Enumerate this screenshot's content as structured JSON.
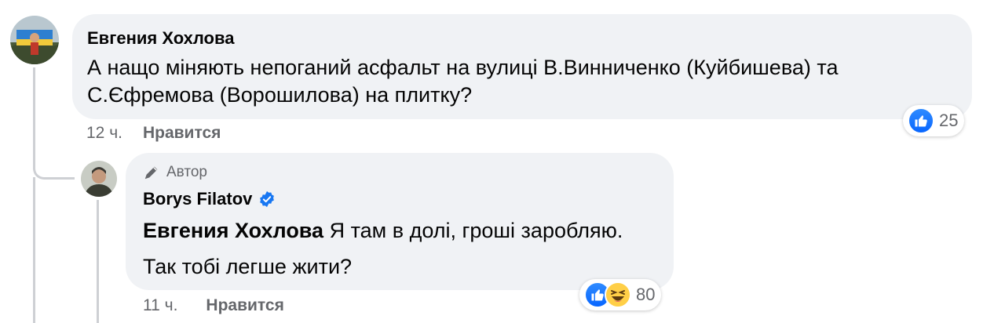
{
  "comment1": {
    "author": "Евгения Хохлова",
    "line1": "А нащо міняють непоганий асфальт на вулиці В.Винниченко (Куйбишева) та",
    "line2": "С.Єфремова (Ворошилова) на плитку?",
    "time": "12 ч.",
    "like_label": "Нравится",
    "reaction_count": "25"
  },
  "reply1": {
    "author_badge": "Автор",
    "author": "Borys Filatov",
    "mention": "Евгения Хохлова",
    "text1": "Я там в долі, гроші заробляю.",
    "text2": "Так тобі легше жити?",
    "time": "11 ч.",
    "like_label": "Нравится",
    "reaction_count": "80"
  },
  "colors": {
    "bubble": "#f0f2f5",
    "like_blue": "#0866ff",
    "verified_blue": "#1877f2",
    "meta_gray": "#65676b"
  },
  "icons": [
    "like-icon",
    "haha-icon",
    "verified-badge-icon",
    "author-pencil-icon"
  ]
}
